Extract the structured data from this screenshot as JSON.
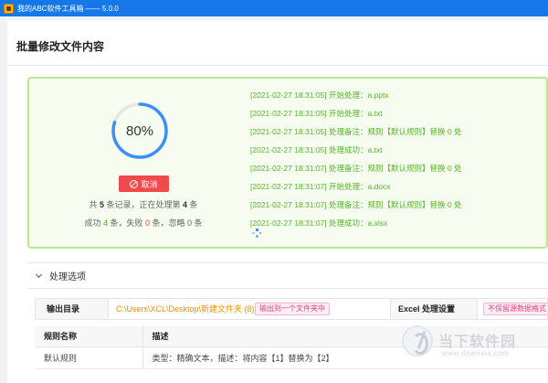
{
  "window": {
    "title": "我的ABC软件工具箱 —— 5.0.0"
  },
  "page": {
    "title": "批量修改文件内容"
  },
  "progress": {
    "percent": 0.8,
    "percent_label": "80%",
    "ring_color": "#3d8ff5",
    "track_color": "#e6e6e6",
    "cancel_label": "取消",
    "summary": {
      "prefix": "共 ",
      "total": "5",
      "mid": " 条记录，正在处理第 ",
      "current": "4",
      "suffix": " 条"
    },
    "counts": {
      "success_label": "成功 ",
      "success": "4",
      "failed_label": " 条，失败 ",
      "failed": "0",
      "ignored_label": " 条，忽略 ",
      "ignored": "0",
      "end": " 条"
    }
  },
  "log": [
    "[2021-02-27 18:31:05] 开始处理：a.pptx",
    "[2021-02-27 18:31:05] 开始处理：a.txt",
    "[2021-02-27 18:31:05] 处理备注：规则【默认规则】替换 0 处",
    "[2021-02-27 18:31:05] 处理成功：a.txt",
    "[2021-02-27 18:31:07] 处理备注：规则【默认规则】替换 0 处",
    "[2021-02-27 18:31:07] 开始处理：a.docx",
    "[2021-02-27 18:31:07] 处理备注：规则【默认规则】替换 0 处",
    "[2021-02-27 18:31:07] 处理成功：a.xlsx"
  ],
  "options": {
    "section_title": "处理选项",
    "output_dir_label": "输出目录",
    "output_dir_value": "C:\\Users\\XCL\\Desktop\\新建文件夹 (8)",
    "output_dir_tag": "输出到一个文件夹中",
    "excel_label": "Excel 处理设置",
    "excel_tag": "不保留源数据格式"
  },
  "rules": {
    "headers": [
      "规则名称",
      "描述"
    ],
    "rows": [
      {
        "name": "默认规则",
        "desc": "类型：精确文本，描述：将内容【1】替换为【2】"
      }
    ]
  },
  "watermark": {
    "name": "当下软件园",
    "url": "www.downxia.com"
  }
}
